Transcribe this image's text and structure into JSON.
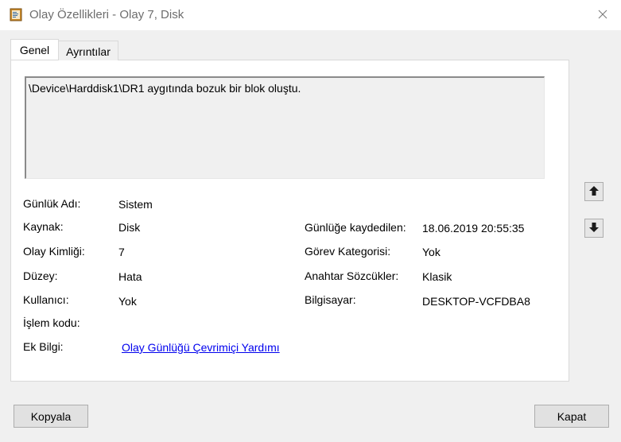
{
  "window": {
    "title": "Olay Özellikleri - Olay 7, Disk"
  },
  "tabs": [
    {
      "label": "Genel",
      "active": true
    },
    {
      "label": "Ayrıntılar",
      "active": false
    }
  ],
  "description": "\\Device\\Harddisk1\\DR1 aygıtında bozuk bir blok oluştu.",
  "fields_left": [
    {
      "label": "Günlük Adı:",
      "value": "Sistem"
    },
    {
      "label": "Kaynak:",
      "value": "Disk"
    },
    {
      "label": "Olay Kimliği:",
      "value": "7"
    },
    {
      "label": "Düzey:",
      "value": "Hata"
    },
    {
      "label": "Kullanıcı:",
      "value": "Yok"
    },
    {
      "label": "İşlem kodu:",
      "value": ""
    },
    {
      "label": "Ek Bilgi:",
      "value": "Olay Günlüğü Çevrimiçi Yardımı"
    }
  ],
  "fields_right": [
    {
      "label": "Günlüğe kaydedilen:",
      "value": "18.06.2019 20:55:35"
    },
    {
      "label": "Görev Kategorisi:",
      "value": "Yok"
    },
    {
      "label": "Anahtar Sözcükler:",
      "value": "Klasik"
    },
    {
      "label": "Bilgisayar:",
      "value": "DESKTOP-VCFDBA8"
    }
  ],
  "buttons": {
    "copy": "Kopyala",
    "close": "Kapat"
  },
  "icons": {
    "app": "event-viewer-icon",
    "close": "close-icon",
    "up": "arrow-up-icon",
    "down": "arrow-down-icon"
  }
}
